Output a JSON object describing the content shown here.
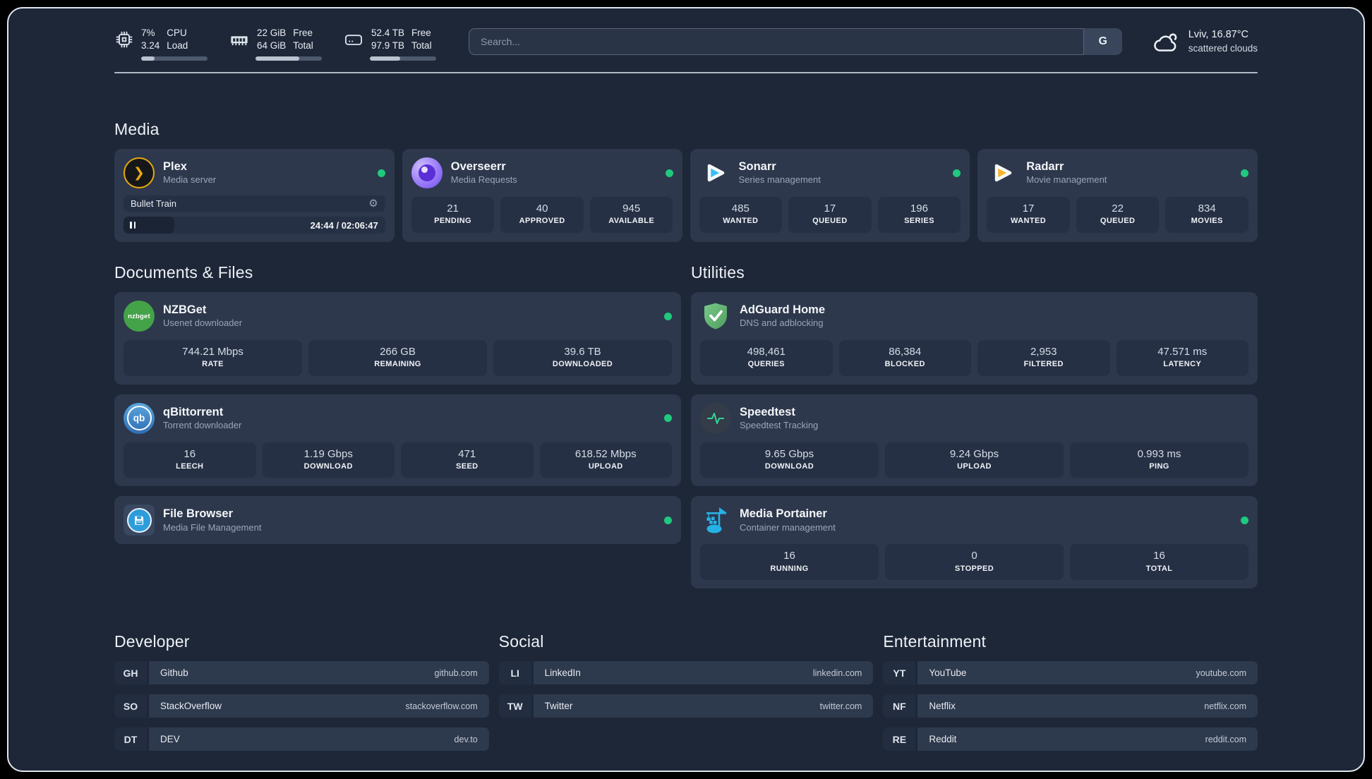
{
  "system": {
    "cpu": {
      "line1": "7%",
      "line2": "3.24",
      "label1": "CPU",
      "label2": "Load",
      "bar_pct": 20
    },
    "ram": {
      "line1": "22 GiB",
      "line2": "64 GiB",
      "label1": "Free",
      "label2": "Total",
      "bar_pct": 66
    },
    "disk": {
      "line1": "52.4 TB",
      "line2": "97.9 TB",
      "label1": "Free",
      "label2": "Total",
      "bar_pct": 46
    }
  },
  "search": {
    "placeholder": "Search...",
    "engine_button": "G"
  },
  "weather": {
    "location_temp": "Lviv, 16.87°C",
    "condition": "scattered clouds"
  },
  "colors": {
    "status_online": "#1fc97e",
    "plex_accent": "#e7a910",
    "sonarr_accent": "#38c0f5",
    "radarr_accent": "#f5b62d",
    "background": "#1e2738",
    "card": "#2d384c"
  },
  "media": {
    "heading": "Media",
    "apps": [
      {
        "name": "Plex",
        "desc": "Media server",
        "now_playing": "Bullet Train",
        "time": "24:44 / 02:06:47",
        "progress_pct": 19.5
      },
      {
        "name": "Overseerr",
        "desc": "Media Requests",
        "stats": [
          {
            "value": "21",
            "label": "PENDING"
          },
          {
            "value": "40",
            "label": "APPROVED"
          },
          {
            "value": "945",
            "label": "AVAILABLE"
          }
        ]
      },
      {
        "name": "Sonarr",
        "desc": "Series management",
        "stats": [
          {
            "value": "485",
            "label": "WANTED"
          },
          {
            "value": "17",
            "label": "QUEUED"
          },
          {
            "value": "196",
            "label": "SERIES"
          }
        ]
      },
      {
        "name": "Radarr",
        "desc": "Movie management",
        "stats": [
          {
            "value": "17",
            "label": "WANTED"
          },
          {
            "value": "22",
            "label": "QUEUED"
          },
          {
            "value": "834",
            "label": "MOVIES"
          }
        ]
      }
    ]
  },
  "documents": {
    "heading": "Documents & Files",
    "apps": [
      {
        "name": "NZBGet",
        "desc": "Usenet downloader",
        "icon_text": "nzbget",
        "stats": [
          {
            "value": "744.21 Mbps",
            "label": "RATE"
          },
          {
            "value": "266 GB",
            "label": "REMAINING"
          },
          {
            "value": "39.6 TB",
            "label": "DOWNLOADED"
          }
        ]
      },
      {
        "name": "qBittorrent",
        "desc": "Torrent downloader",
        "icon_text": "qb",
        "stats": [
          {
            "value": "16",
            "label": "LEECH"
          },
          {
            "value": "1.19 Gbps",
            "label": "DOWNLOAD"
          },
          {
            "value": "471",
            "label": "SEED"
          },
          {
            "value": "618.52 Mbps",
            "label": "UPLOAD"
          }
        ]
      },
      {
        "name": "File Browser",
        "desc": "Media File Management",
        "stats": []
      }
    ]
  },
  "utilities": {
    "heading": "Utilities",
    "apps": [
      {
        "name": "AdGuard Home",
        "desc": "DNS and adblocking",
        "stats": [
          {
            "value": "498,461",
            "label": "QUERIES"
          },
          {
            "value": "86,384",
            "label": "BLOCKED"
          },
          {
            "value": "2,953",
            "label": "FILTERED"
          },
          {
            "value": "47.571 ms",
            "label": "LATENCY"
          }
        ]
      },
      {
        "name": "Speedtest",
        "desc": "Speedtest Tracking",
        "stats": [
          {
            "value": "9.65 Gbps",
            "label": "DOWNLOAD"
          },
          {
            "value": "9.24 Gbps",
            "label": "UPLOAD"
          },
          {
            "value": "0.993 ms",
            "label": "PING"
          }
        ]
      },
      {
        "name": "Media Portainer",
        "desc": "Container management",
        "stats": [
          {
            "value": "16",
            "label": "RUNNING"
          },
          {
            "value": "0",
            "label": "STOPPED"
          },
          {
            "value": "16",
            "label": "TOTAL"
          }
        ]
      }
    ]
  },
  "links": {
    "developer": {
      "heading": "Developer",
      "items": [
        {
          "abbr": "GH",
          "name": "Github",
          "url": "github.com"
        },
        {
          "abbr": "SO",
          "name": "StackOverflow",
          "url": "stackoverflow.com"
        },
        {
          "abbr": "DT",
          "name": "DEV",
          "url": "dev.to"
        }
      ]
    },
    "social": {
      "heading": "Social",
      "items": [
        {
          "abbr": "LI",
          "name": "LinkedIn",
          "url": "linkedin.com"
        },
        {
          "abbr": "TW",
          "name": "Twitter",
          "url": "twitter.com"
        }
      ]
    },
    "entertainment": {
      "heading": "Entertainment",
      "items": [
        {
          "abbr": "YT",
          "name": "YouTube",
          "url": "youtube.com"
        },
        {
          "abbr": "NF",
          "name": "Netflix",
          "url": "netflix.com"
        },
        {
          "abbr": "RE",
          "name": "Reddit",
          "url": "reddit.com"
        }
      ]
    }
  }
}
